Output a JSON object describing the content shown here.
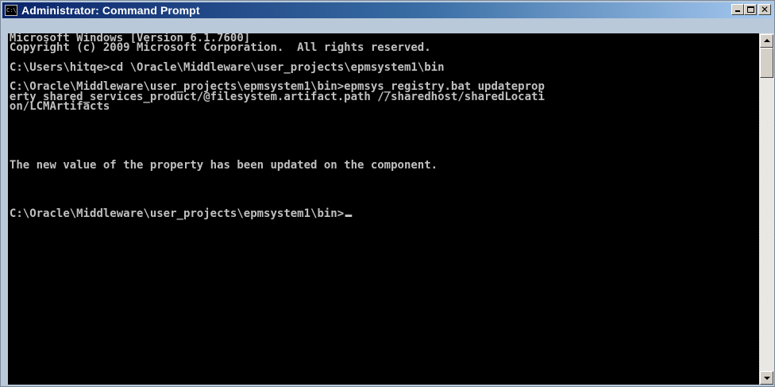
{
  "window": {
    "title": "Administrator: Command Prompt",
    "icon_label": "C:\\."
  },
  "console": {
    "lines": [
      "Microsoft Windows [Version 6.1.7600]",
      "Copyright (c) 2009 Microsoft Corporation.  All rights reserved.",
      "",
      "C:\\Users\\hitqe>cd \\Oracle\\Middleware\\user_projects\\epmsystem1\\bin",
      "",
      "C:\\Oracle\\Middleware\\user_projects\\epmsystem1\\bin>epmsys_registry.bat updateprop",
      "erty shared_services_product/@filesystem.artifact.path //sharedhost/sharedLocati",
      "on/LCMArtifacts",
      "",
      "",
      "",
      "",
      "",
      "The new value of the property has been updated on the component.",
      "",
      "",
      "",
      "",
      "C:\\Oracle\\Middleware\\user_projects\\epmsystem1\\bin>"
    ]
  },
  "colors": {
    "console_background": "#000000",
    "console_text": "#c0c0c0",
    "titlebar_start": "#0a246a",
    "titlebar_end": "#a6caf0"
  },
  "icons": {
    "app": "cmd-icon",
    "minimize": "minimize-icon",
    "maximize": "maximize-icon",
    "close": "close-icon",
    "scroll_up": "arrow-up-icon",
    "scroll_down": "arrow-down-icon"
  }
}
